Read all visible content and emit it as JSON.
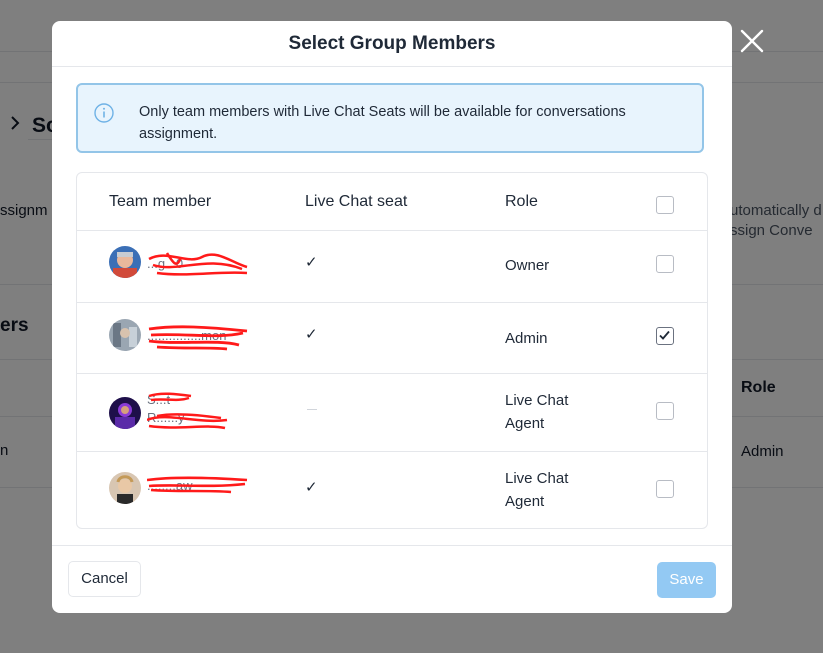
{
  "background": {
    "breadcrumb_partial": "So",
    "left_partial_1": "ssignm",
    "left_partial_2": "ers",
    "left_partial_3": "n",
    "right_partial_1": "utomatically d",
    "right_partial_2": "ssign Conve",
    "right_header_role": "Role",
    "right_cell_role": "Admin"
  },
  "modal": {
    "title": "Select Group Members",
    "info_message": "Only team members with Live Chat Seats will be available for conversations assignment.",
    "columns": {
      "member": "Team member",
      "seat": "Live Chat seat",
      "role": "Role"
    },
    "members": [
      {
        "name_fragment": "...g...0",
        "has_seat": true,
        "role": "Owner",
        "selected": false
      },
      {
        "name_fragment": "...............mon",
        "has_seat": true,
        "role": "Admin",
        "selected": true
      },
      {
        "name_fragment_1": "S...t",
        "name_fragment_2": "R......y",
        "has_seat": false,
        "role_line1": "Live Chat",
        "role_line2": "Agent",
        "selected": false
      },
      {
        "name_fragment": "........aw",
        "has_seat": true,
        "role_line1": "Live Chat",
        "role_line2": "Agent",
        "selected": false
      }
    ],
    "seat_check_symbol": "✓",
    "cancel_label": "Cancel",
    "save_label": "Save"
  },
  "colors": {
    "overlay": "rgba(0,0,0,0.5)",
    "info_bg": "#e8f4fd",
    "info_border": "#93c5e8",
    "save_disabled": "#93c9f3",
    "redaction": "#ff1a1a"
  },
  "icons": {
    "close": "close-icon",
    "info": "info-icon",
    "checkmark": "checkmark-icon",
    "chevron": "chevron-right-icon"
  }
}
